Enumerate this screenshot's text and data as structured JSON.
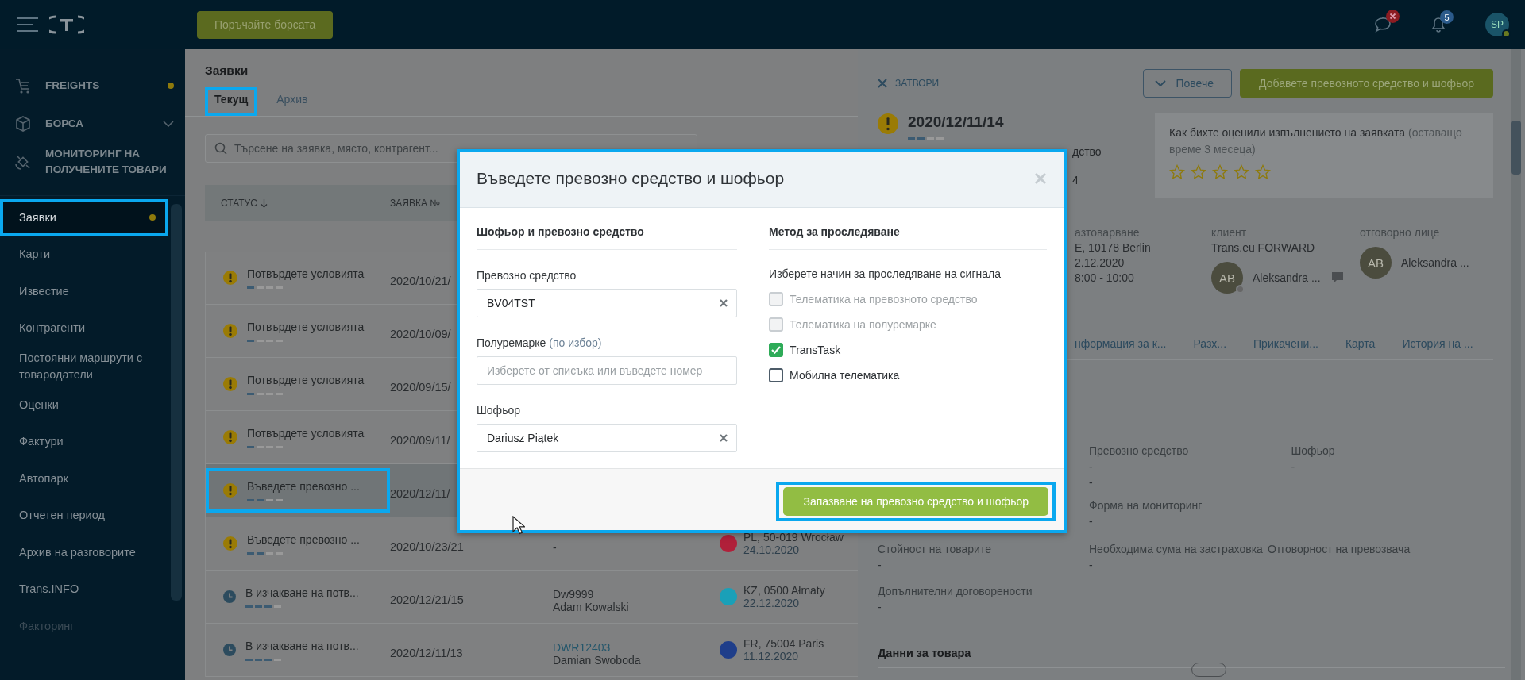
{
  "top_bar": {
    "exchange_button": "Поръчайте борсата",
    "notifications_count": "5",
    "user_initials": "SP"
  },
  "sidebar": {
    "sections": [
      {
        "label": "FREIGHTS",
        "dot": true,
        "expandable": false
      },
      {
        "label": "БОРСА",
        "dot": false,
        "expandable": true
      },
      {
        "label": "МОНИТОРИНГ НА ПОЛУЧЕНИТЕ ТОВАРИ",
        "dot": false,
        "expandable": false
      }
    ],
    "items": [
      {
        "label": "Заявки",
        "selected": true,
        "dot": true,
        "highlighted": true,
        "disabled": false
      },
      {
        "label": "Карти",
        "selected": false,
        "dot": false,
        "highlighted": false,
        "disabled": false
      },
      {
        "label": "Известие",
        "selected": false,
        "dot": false,
        "highlighted": false,
        "disabled": false
      },
      {
        "label": "Контрагенти",
        "selected": false,
        "dot": false,
        "highlighted": false,
        "disabled": false
      },
      {
        "label": "Постоянни маршрути с товародатели",
        "selected": false,
        "dot": false,
        "highlighted": false,
        "disabled": false
      },
      {
        "label": "Оценки",
        "selected": false,
        "dot": false,
        "highlighted": false,
        "disabled": false
      },
      {
        "label": "Фактури",
        "selected": false,
        "dot": false,
        "highlighted": false,
        "disabled": false
      },
      {
        "label": "Автопарк",
        "selected": false,
        "dot": false,
        "highlighted": false,
        "disabled": false
      },
      {
        "label": "Отчетен период",
        "selected": false,
        "dot": false,
        "highlighted": false,
        "disabled": false
      },
      {
        "label": "Архив на разговорите",
        "selected": false,
        "dot": false,
        "highlighted": false,
        "disabled": false
      },
      {
        "label": "Trans.INFO",
        "selected": false,
        "dot": false,
        "highlighted": false,
        "disabled": false
      },
      {
        "label": "Факторинг",
        "selected": false,
        "dot": false,
        "highlighted": false,
        "disabled": true
      }
    ]
  },
  "orders": {
    "title": "Заявки",
    "tabs": [
      {
        "label": "Текущ",
        "selected": true,
        "highlighted": true
      },
      {
        "label": "Архив",
        "selected": false,
        "highlighted": false
      }
    ],
    "search": {
      "placeholder": "Търсене на заявка, място, контрагент..."
    },
    "columns": [
      {
        "label": "СТАТУС",
        "sorted": true
      },
      {
        "label": "ЗАЯВКА №",
        "sorted": false
      }
    ],
    "rows": [
      {
        "status": "Потвърдете условията",
        "kind": "warning",
        "level": 0.25,
        "number": "2020/10/21/",
        "selected": false,
        "highlighted": false
      },
      {
        "status": "Потвърдете условията",
        "kind": "warning",
        "level": 0.25,
        "number": "2020/10/09/",
        "selected": false,
        "highlighted": false
      },
      {
        "status": "Потвърдете условията",
        "kind": "warning",
        "level": 0.25,
        "number": "2020/09/15/",
        "selected": false,
        "highlighted": false
      },
      {
        "status": "Потвърдете условията",
        "kind": "warning",
        "level": 0.25,
        "number": "2020/09/11/",
        "selected": false,
        "highlighted": false
      },
      {
        "status": "Въведете превозно ...",
        "kind": "warning",
        "level": 0.5,
        "number": "2020/12/11/",
        "selected": true,
        "highlighted": true
      },
      {
        "status": "Въведете превозно ...",
        "kind": "warning",
        "level": 0.5,
        "number": "2020/10/23/21",
        "vehicle": "-",
        "vehicle_link": false,
        "place": "PL, 50-019 Wrocław",
        "date": "24.10.2020",
        "color": "#b0203a",
        "selected": false,
        "highlighted": false
      },
      {
        "status": "В изчакване на потв...",
        "kind": "pending",
        "level": 0.75,
        "number": "2020/12/21/15",
        "vehicle": "Dw9999",
        "vehicle_link": false,
        "driver": "Adam Kowalski",
        "place": "KZ, 0500 Ałmaty",
        "date": "22.12.2020",
        "color": "#1aa0b8",
        "selected": false,
        "highlighted": false
      },
      {
        "status": "В изчакване на потв...",
        "kind": "pending",
        "level": 0.75,
        "number": "2020/12/11/13",
        "vehicle": "DWR12403",
        "vehicle_link": true,
        "driver": "Damian Swoboda",
        "place": "FR, 75004 Paris",
        "date": "11.12.2020",
        "color": "#1f3e8a",
        "selected": false,
        "highlighted": false
      }
    ]
  },
  "right_panel": {
    "close_label": "ЗАТВОРИ",
    "more_button": "Повече",
    "add_button": "Добавете превозното средство и шофьор",
    "order": {
      "number": "2020/12/11/14",
      "kind": "warning",
      "level": 0.5
    },
    "status_fragments": [
      "дство",
      "4"
    ],
    "rating": {
      "question": "Как бихте оценили изпълнението на заявката",
      "remaining": "(оставащо време 3 месеца)",
      "stars": 0
    },
    "details": [
      {
        "label": "азтоварване",
        "values": [
          "E, 10178 Berlin",
          "2.12.2020",
          "8:00 - 10:00"
        ]
      },
      {
        "label": "клиент",
        "values": [
          "Trans.eu FORWARD"
        ],
        "person": {
          "initials": "AB",
          "name": "Aleksandra ...",
          "status_dot": true,
          "chat": true
        }
      },
      {
        "label": "отговорно лице",
        "person": {
          "initials": "AB",
          "name": "Aleksandra ...",
          "status_dot": false,
          "chat": false
        }
      }
    ],
    "tabs": [
      "нформация за к...",
      "Разх...",
      "Прикачени...",
      "Карта",
      "История на ..."
    ],
    "field_rows": [
      {
        "first_column_covered": true,
        "cells": [
          {
            "label": "Превозно средство",
            "values": [
              "-",
              "-"
            ]
          },
          {
            "label": "Шофьор",
            "values": [
              "-"
            ]
          }
        ]
      },
      {
        "first_column_covered": true,
        "cells": [
          {
            "label": "Форма на мониторинг",
            "values": [
              "-"
            ]
          }
        ]
      },
      {
        "first_column_covered": false,
        "cells": [
          {
            "label": "Стойност на товарите",
            "values": [
              "-"
            ]
          },
          {
            "label": "Необходима сума на застраховка",
            "values": [
              "-"
            ]
          },
          {
            "label": "Отговорност на превозвача"
          }
        ]
      },
      {
        "first_column_covered": false,
        "cells": [
          {
            "label": "Допълнителни договорености",
            "values": [
              "-"
            ]
          }
        ]
      }
    ],
    "cargo_title": "Данни за товара"
  },
  "dialog": {
    "title": "Въведете превозно средство и шофьор",
    "highlighted": true,
    "left_heading": "Шофьор и превозно средство",
    "fields": [
      {
        "label": "Превозно средство",
        "value": "BV04TST",
        "clearable": true
      },
      {
        "label": "Полуремарке",
        "optional": "(по избор)",
        "placeholder": "Изберете от списъка или въведете номер",
        "clearable": false
      },
      {
        "label": "Шофьор",
        "value": "Dariusz Piątek",
        "clearable": true
      }
    ],
    "right_heading": "Метод за проследяване",
    "hint": "Изберете начин за проследяване на сигнала",
    "options": [
      {
        "label": "Телематика на превозното средство",
        "checked": false,
        "disabled": true
      },
      {
        "label": "Телематика на полуремарке",
        "checked": false,
        "disabled": true
      },
      {
        "label": "TransTask",
        "checked": true,
        "disabled": false
      },
      {
        "label": "Мобилна телематика",
        "checked": false,
        "disabled": false
      }
    ],
    "save_button": {
      "label": "Запазване на превозно средство и шофьор",
      "highlighted": true
    }
  }
}
